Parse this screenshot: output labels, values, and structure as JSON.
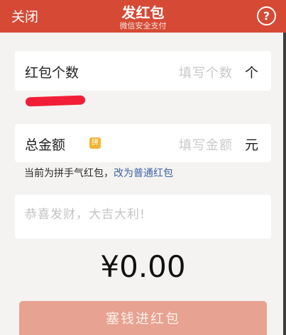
{
  "header": {
    "close_label": "关闭",
    "title": "发红包",
    "subtitle": "微信安全支付",
    "help_label": "?"
  },
  "count_field": {
    "label": "红包个数",
    "placeholder": "填写个数",
    "unit": "个"
  },
  "amount_field": {
    "label": "总金额",
    "badge": "拼",
    "placeholder": "填写金额",
    "unit": "元"
  },
  "mode_info": {
    "text": "当前为拼手气红包，",
    "link": "改为普通红包"
  },
  "blessing": {
    "placeholder": "恭喜发财，大吉大利!"
  },
  "total_amount": "¥0.00",
  "submit_label": "塞钱进红包",
  "colors": {
    "header": "#d64a35",
    "button": "#e7a291",
    "link": "#3f63a8",
    "badge": "#f3b433"
  }
}
